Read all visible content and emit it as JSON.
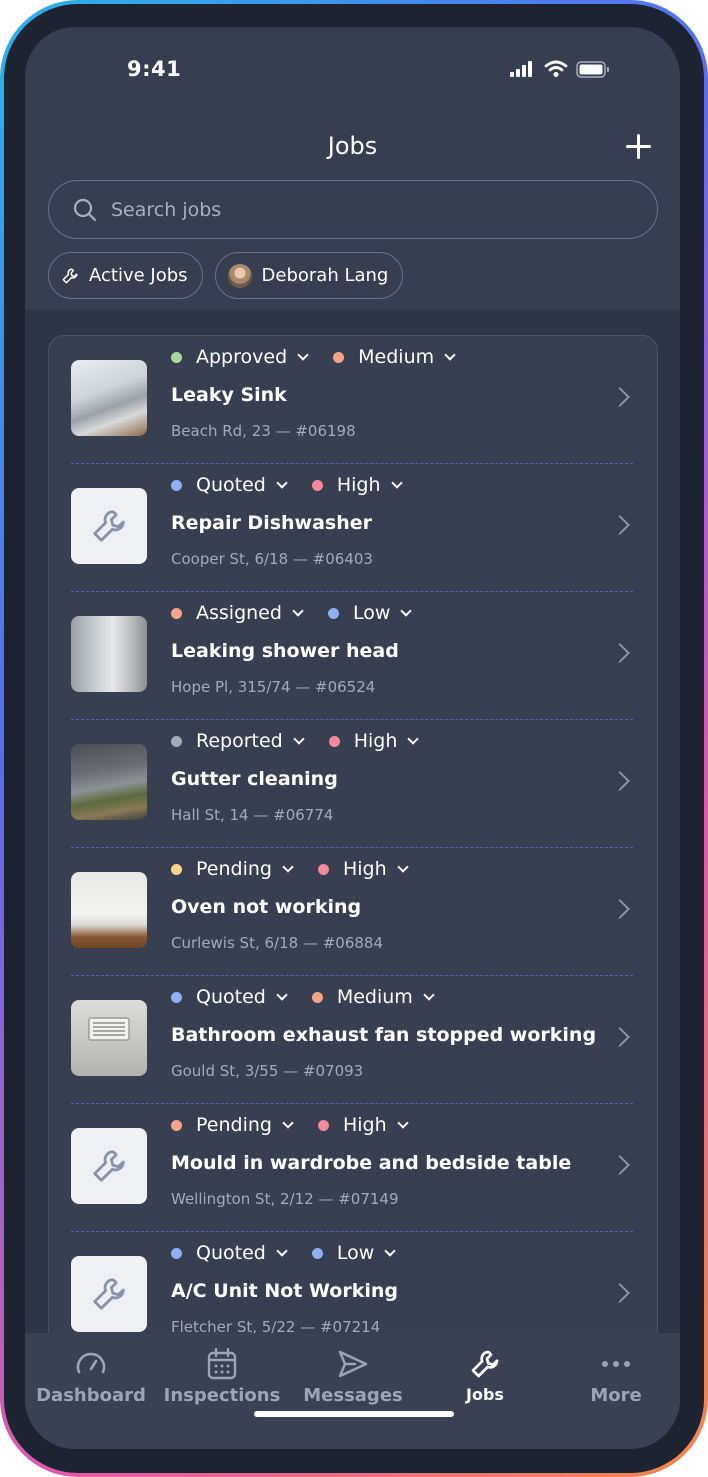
{
  "status_bar": {
    "time": "9:41"
  },
  "header": {
    "title": "Jobs"
  },
  "search": {
    "placeholder": "Search jobs"
  },
  "filters": [
    {
      "label": "Active Jobs",
      "icon": "wrench-icon"
    },
    {
      "label": "Deborah Lang",
      "icon": "avatar"
    }
  ],
  "jobs": [
    {
      "status": "Approved",
      "status_color": "#a8d89b",
      "priority": "Medium",
      "priority_color": "#f5a48a",
      "title": "Leaky Sink",
      "address": "Beach Rd, 23 — #06198",
      "thumb": "sink"
    },
    {
      "status": "Quoted",
      "status_color": "#8fb0f2",
      "priority": "High",
      "priority_color": "#f28a9a",
      "title": "Repair Dishwasher",
      "address": "Cooper St, 6/18 — #06403",
      "thumb": "placeholder"
    },
    {
      "status": "Assigned",
      "status_color": "#f5a48a",
      "priority": "Low",
      "priority_color": "#8fb0f2",
      "title": "Leaking shower head",
      "address": "Hope Pl, 315/74 — #06524",
      "thumb": "shower"
    },
    {
      "status": "Reported",
      "status_color": "#a3aab8",
      "priority": "High",
      "priority_color": "#f28a9a",
      "title": "Gutter cleaning",
      "address": "Hall St, 14 — #06774",
      "thumb": "gutter"
    },
    {
      "status": "Pending",
      "status_color": "#f6d48a",
      "priority": "High",
      "priority_color": "#f28a9a",
      "title": "Oven not working",
      "address": "Curlewis St, 6/18 — #06884",
      "thumb": "oven"
    },
    {
      "status": "Quoted",
      "status_color": "#8fb0f2",
      "priority": "Medium",
      "priority_color": "#f5a48a",
      "title": "Bathroom exhaust fan stopped working",
      "address": "Gould St, 3/55 — #07093",
      "thumb": "vent"
    },
    {
      "status": "Pending",
      "status_color": "#f5a48a",
      "priority": "High",
      "priority_color": "#f28a9a",
      "title": "Mould in wardrobe and bedside table",
      "address": "Wellington St, 2/12 — #07149",
      "thumb": "placeholder"
    },
    {
      "status": "Quoted",
      "status_color": "#8fb0f2",
      "priority": "Low",
      "priority_color": "#8fb0f2",
      "title": "A/C Unit Not Working",
      "address": "Fletcher St, 5/22 — #07214",
      "thumb": "placeholder"
    }
  ],
  "nav": [
    {
      "label": "Dashboard",
      "icon": "gauge-icon",
      "active": false
    },
    {
      "label": "Inspections",
      "icon": "calendar-icon",
      "active": false
    },
    {
      "label": "Messages",
      "icon": "send-icon",
      "active": false
    },
    {
      "label": "Jobs",
      "icon": "wrench-icon",
      "active": true
    },
    {
      "label": "More",
      "icon": "more-icon",
      "active": false
    }
  ]
}
